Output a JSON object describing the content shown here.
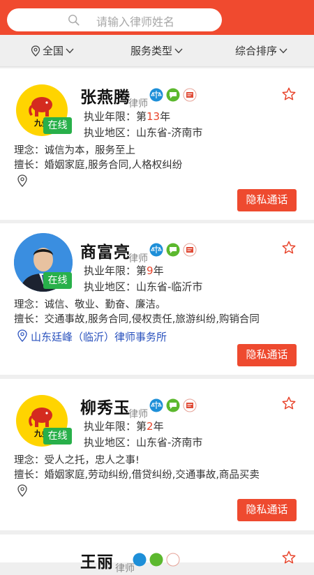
{
  "search": {
    "placeholder": "请输入律师姓名"
  },
  "filters": [
    {
      "label": "全国"
    },
    {
      "label": "服务类型"
    },
    {
      "label": "综合排序"
    }
  ],
  "labels": {
    "online": "在线",
    "lawyer": "律师",
    "years_prefix": "执业年限：第",
    "years_suffix": "年",
    "region_prefix": "执业地区：",
    "philosophy_prefix": "理念：",
    "expertise_prefix": "擅长：",
    "call_button": "隐私通话"
  },
  "lawyers": [
    {
      "name": "张燕腾",
      "years": "13",
      "region": "山东省-济南市",
      "philosophy": "诚信为本，服务至上",
      "expertise": "婚姻家庭,服务合同,人格权纠纷",
      "firm": "",
      "avatar": "九务网 logo"
    },
    {
      "name": "商富亮",
      "years": "9",
      "region": "山东省-临沂市",
      "philosophy": "诚信、敬业、勤奋、廉洁。",
      "expertise": "交通事故,服务合同,侵权责任,旅游纠纷,购销合同",
      "firm": "山东廷峰（临沂）律师事务所",
      "avatar": "photo"
    },
    {
      "name": "柳秀玉",
      "years": "2",
      "region": "山东省-济南市",
      "philosophy": "受人之托，忠人之事!",
      "expertise": "婚姻家庭,劳动纠纷,借贷纠纷,交通事故,商品买卖",
      "firm": "",
      "avatar": "九务网 logo"
    },
    {
      "name": "王丽"
    }
  ],
  "colors": {
    "brand": "#f04a2f",
    "online": "#28b04a",
    "accent_text": "#e8442b",
    "firm_link": "#2a52be"
  }
}
